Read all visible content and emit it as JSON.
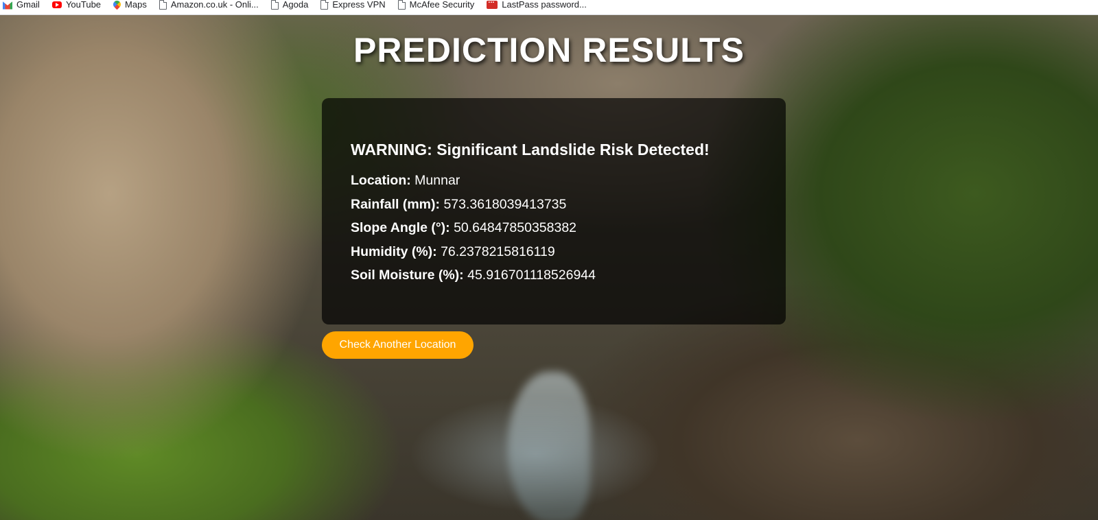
{
  "bookmarks": [
    {
      "label": "Gmail",
      "icon": "gmail-icon"
    },
    {
      "label": "YouTube",
      "icon": "youtube-icon"
    },
    {
      "label": "Maps",
      "icon": "maps-icon"
    },
    {
      "label": "Amazon.co.uk - Onli...",
      "icon": "page-icon"
    },
    {
      "label": "Agoda",
      "icon": "page-icon"
    },
    {
      "label": "Express VPN",
      "icon": "page-icon"
    },
    {
      "label": "McAfee Security",
      "icon": "page-icon"
    },
    {
      "label": "LastPass password...",
      "icon": "lastpass-icon"
    }
  ],
  "page": {
    "title": "PREDICTION RESULTS"
  },
  "result": {
    "warning": "WARNING: Significant Landslide Risk Detected!",
    "fields": [
      {
        "label": "Location:",
        "value": "Munnar"
      },
      {
        "label": "Rainfall (mm):",
        "value": "573.3618039413735"
      },
      {
        "label": "Slope Angle (°):",
        "value": "50.64847850358382"
      },
      {
        "label": "Humidity (%):",
        "value": "76.2378215816119"
      },
      {
        "label": "Soil Moisture (%):",
        "value": "45.916701118526944"
      }
    ]
  },
  "actions": {
    "check_another_label": "Check Another Location"
  },
  "colors": {
    "button": "#ffa500",
    "card_background": "rgba(0,0,0,0.68)",
    "text": "#ffffff"
  }
}
